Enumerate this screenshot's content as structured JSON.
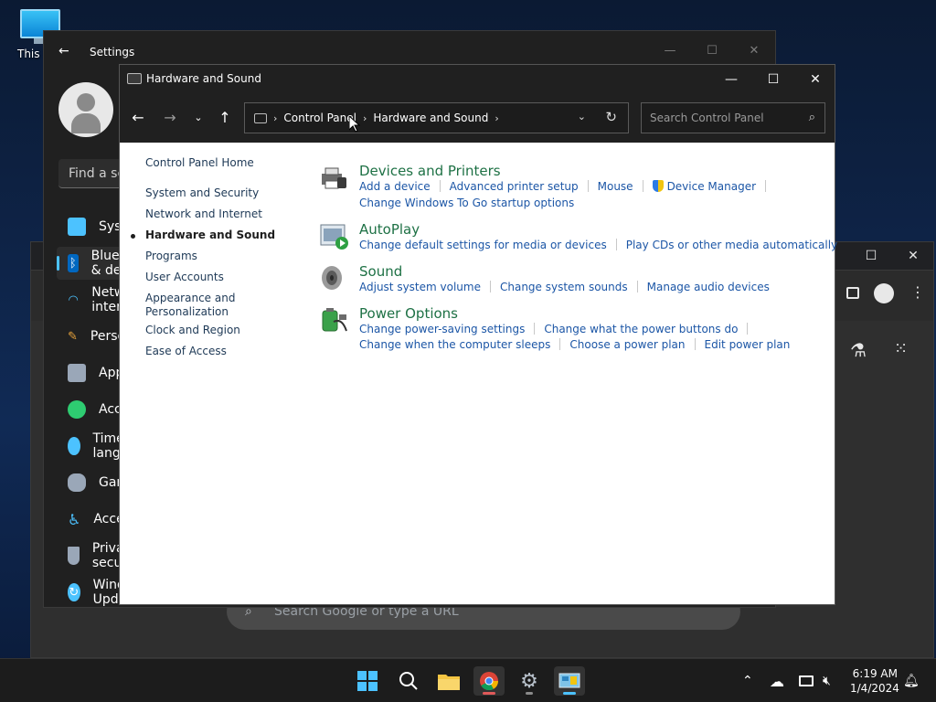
{
  "desktop": {
    "icon_label": "This PC"
  },
  "settings": {
    "title": "Settings",
    "search_placeholder": "Find a setting",
    "nav": [
      {
        "label": "System",
        "icon": "monitor-icon",
        "color": "#4cc2ff"
      },
      {
        "label": "Bluetooth & devices",
        "icon": "bluetooth-icon",
        "color": "#0067c0"
      },
      {
        "label": "Network & internet",
        "icon": "wifi-icon",
        "color": "#4cc2ff"
      },
      {
        "label": "Personalization",
        "icon": "brush-icon",
        "color": "#e8a33c"
      },
      {
        "label": "Apps",
        "icon": "apps-icon",
        "color": "#9aa7b8"
      },
      {
        "label": "Accounts",
        "icon": "person-icon",
        "color": "#2ecc71"
      },
      {
        "label": "Time & language",
        "icon": "clock-icon",
        "color": "#4cc2ff"
      },
      {
        "label": "Gaming",
        "icon": "gamepad-icon",
        "color": "#9aa7b8"
      },
      {
        "label": "Accessibility",
        "icon": "accessibility-icon",
        "color": "#4cc2ff"
      },
      {
        "label": "Privacy & security",
        "icon": "shield-icon",
        "color": "#9aa7b8"
      },
      {
        "label": "Windows Update",
        "icon": "update-icon",
        "color": "#4cc2ff"
      }
    ]
  },
  "chrome": {
    "search_placeholder": "Search Google or type a URL"
  },
  "control_panel": {
    "title": "Hardware and Sound",
    "breadcrumb": [
      "Control Panel",
      "Hardware and Sound"
    ],
    "search_placeholder": "Search Control Panel",
    "left_nav": [
      {
        "label": "Control Panel Home",
        "current": false
      },
      {
        "label": "System and Security",
        "current": false
      },
      {
        "label": "Network and Internet",
        "current": false
      },
      {
        "label": "Hardware and Sound",
        "current": true
      },
      {
        "label": "Programs",
        "current": false
      },
      {
        "label": "User Accounts",
        "current": false
      },
      {
        "label": "Appearance and Personalization",
        "current": false
      },
      {
        "label": "Clock and Region",
        "current": false
      },
      {
        "label": "Ease of Access",
        "current": false
      }
    ],
    "categories": [
      {
        "title": "Devices and Printers",
        "icon": "printer-icon",
        "links": [
          [
            "Add a device",
            "Advanced printer setup",
            "Mouse",
            "Device Manager"
          ],
          [
            "Change Windows To Go startup options"
          ]
        ]
      },
      {
        "title": "AutoPlay",
        "icon": "autoplay-icon",
        "links": [
          [
            "Change default settings for media or devices",
            "Play CDs or other media automatically"
          ]
        ]
      },
      {
        "title": "Sound",
        "icon": "speaker-icon",
        "links": [
          [
            "Adjust system volume",
            "Change system sounds",
            "Manage audio devices"
          ]
        ]
      },
      {
        "title": "Power Options",
        "icon": "battery-icon",
        "links": [
          [
            "Change power-saving settings",
            "Change what the power buttons do"
          ],
          [
            "Change when the computer sleeps",
            "Choose a power plan",
            "Edit power plan"
          ]
        ]
      }
    ]
  },
  "taskbar": {
    "time": "6:19 AM",
    "date": "1/4/2024"
  }
}
